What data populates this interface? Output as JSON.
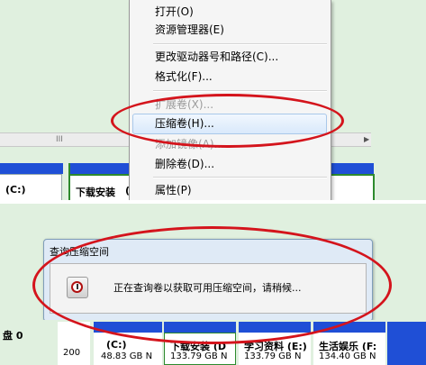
{
  "top_panel": {
    "drive_c_label": "(C:)",
    "drive_d_label": "下载安装",
    "drive_d_suffix": "(",
    "scroll_grip": "III"
  },
  "context_menu": {
    "items": [
      {
        "label": "打开(O)",
        "enabled": true
      },
      {
        "label": "资源管理器(E)",
        "enabled": true
      },
      {
        "label": "更改驱动器号和路径(C)...",
        "enabled": true
      },
      {
        "label": "格式化(F)...",
        "enabled": true
      },
      {
        "label": "扩展卷(X)...",
        "enabled": false
      },
      {
        "label": "压缩卷(H)...",
        "enabled": true,
        "highlighted": true
      },
      {
        "label": "添加镜像(A)...",
        "enabled": false
      },
      {
        "label": "删除卷(D)...",
        "enabled": true
      },
      {
        "label": "属性(P)",
        "enabled": true
      }
    ]
  },
  "dialog": {
    "title": "查询压缩空间",
    "message": "正在查询卷以获取可用压缩空间，请稍候..."
  },
  "bottom_panel": {
    "disk_label": "盘 0",
    "disk_size": "200",
    "volumes": [
      {
        "label": "(C:)",
        "size": "48.83 GB N"
      },
      {
        "label": "下载安装 (D",
        "size": "133.79 GB N"
      },
      {
        "label": "学习资料 (E:)",
        "size": "133.79 GB N"
      },
      {
        "label": "生活娱乐 (F:",
        "size": "134.40 GB N"
      }
    ]
  },
  "colors": {
    "highlight_ring": "#d4141c",
    "volume_bar": "#1f4fd6",
    "panel_bg": "#e0f0df"
  }
}
